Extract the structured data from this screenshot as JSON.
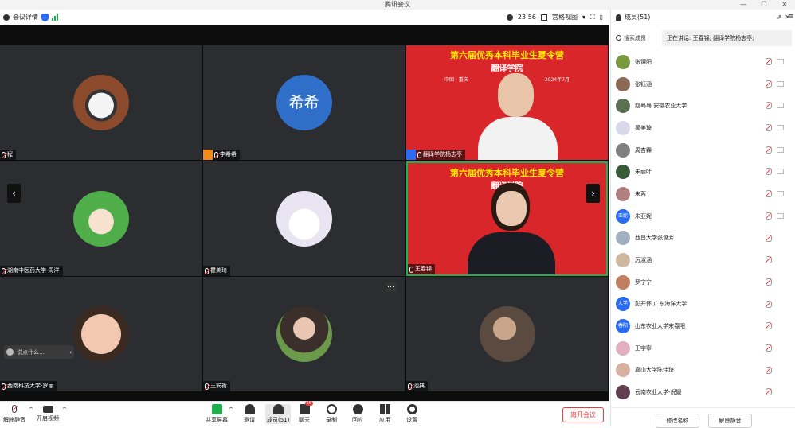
{
  "window": {
    "title": "腾讯会议"
  },
  "topbar": {
    "meeting_info": "会议详情",
    "timer": "23:56",
    "view_label": "宫格视图"
  },
  "tiles": [
    {
      "name": "程"
    },
    {
      "name": "李希希",
      "avatar_text": "希希"
    },
    {
      "name": "翻译学院杨志亭"
    },
    {
      "name": "湖南中医药大学-周洋"
    },
    {
      "name": "瞿美琦"
    },
    {
      "name": "王春锦"
    },
    {
      "name": "西南科技大学-罗丽"
    },
    {
      "name": "王安祈"
    },
    {
      "name": "池典"
    }
  ],
  "banner": {
    "title": "第六届优秀本科毕业生夏令营",
    "subtitle": "翻译学院",
    "place": "中国 · 重庆",
    "date": "2024年7月"
  },
  "chat_placeholder": "说点什么...",
  "bottombar": {
    "mute": "解除静音",
    "video": "开启视频",
    "share": "共享屏幕",
    "invite": "邀请",
    "members": "成员(51)",
    "chat": "聊天",
    "chat_badge": "25",
    "record": "录制",
    "reaction": "回应",
    "apps": "应用",
    "settings": "设置",
    "leave": "离开会议"
  },
  "panel": {
    "title": "成员(51)",
    "search": "搜索成员",
    "speaking": "正在讲话: 王春锦; 翻译学院杨志亭;",
    "members": [
      {
        "name": "张谭阳",
        "color": "#7a9a40"
      },
      {
        "name": "张钰涵",
        "color": "#8a6a55"
      },
      {
        "name": "赵蓦蓦 安徽农业大学",
        "color": "#5a7050"
      },
      {
        "name": "瞿美琦",
        "color": "#d8d8e8"
      },
      {
        "name": "周杏霖",
        "color": "#808080"
      },
      {
        "name": "朱丽叶",
        "color": "#3a5a3a"
      },
      {
        "name": "朱蓉",
        "color": "#b08080"
      },
      {
        "name": "朱亚妮",
        "avatar_text": "亚妮",
        "color": "#2a6df4"
      },
      {
        "name": "西昌大学张璐芳",
        "color": "#a0b0c0"
      },
      {
        "name": "厉淑涵",
        "color": "#d0b8a0"
      },
      {
        "name": "罗宁宁",
        "color": "#c08060"
      },
      {
        "name": "彭开怀 广东海洋大学",
        "avatar_text": "大学",
        "color": "#2a6df4"
      },
      {
        "name": "山东农业大学宋春阳",
        "avatar_text": "春阳",
        "color": "#2a6df4"
      },
      {
        "name": "王宇寧",
        "color": "#e0b0c0"
      },
      {
        "name": "嘉山大学陈佳琦",
        "color": "#d8b0a0"
      },
      {
        "name": "云南农业大学-倪媛",
        "color": "#604050"
      }
    ],
    "rename": "修改名称",
    "unmute": "解除静音"
  },
  "colors": {
    "accent": "#2a6df4",
    "danger": "#e63c3c",
    "banner_red": "#d8262a",
    "speaker_border": "#1fb14f"
  }
}
